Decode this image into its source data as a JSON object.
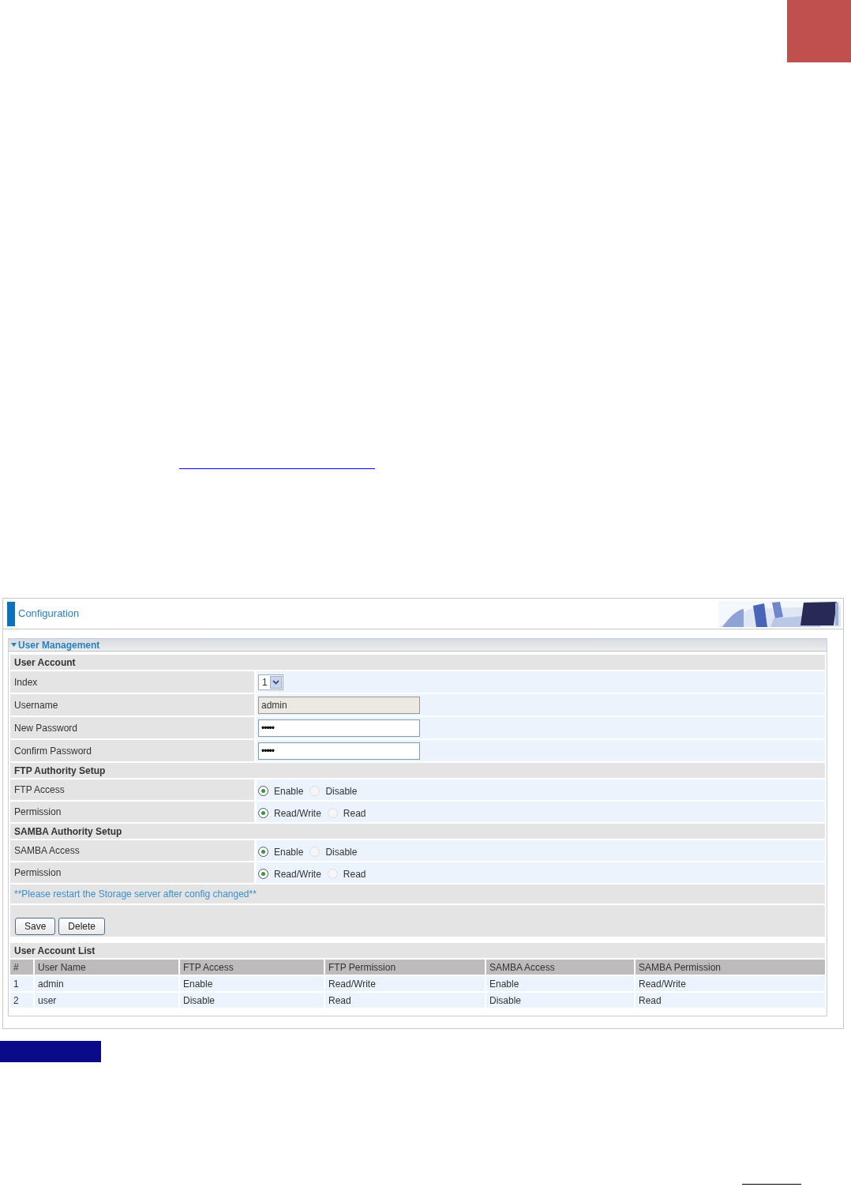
{
  "window": {
    "title": "Configuration"
  },
  "section": {
    "title": "User Management",
    "expanded": true
  },
  "groups": [
    {
      "heading": "User Account",
      "rows": [
        {
          "label": "Index",
          "kind": "select",
          "value": "1"
        },
        {
          "label": "Username",
          "kind": "text",
          "value": "admin",
          "disabled": true
        },
        {
          "label": "New Password",
          "kind": "password",
          "value": "•••••"
        },
        {
          "label": "Confirm Password",
          "kind": "password",
          "value": "•••••"
        }
      ]
    },
    {
      "heading": "FTP Authority Setup",
      "rows": [
        {
          "label": "FTP Access",
          "kind": "radio",
          "options": [
            {
              "label": "Enable",
              "selected": true
            },
            {
              "label": "Disable",
              "selected": false
            }
          ]
        },
        {
          "label": "Permission",
          "kind": "radio",
          "options": [
            {
              "label": "Read/Write",
              "selected": true
            },
            {
              "label": "Read",
              "selected": false
            }
          ]
        }
      ]
    },
    {
      "heading": "SAMBA Authority Setup",
      "rows": [
        {
          "label": "SAMBA Access",
          "kind": "radio",
          "options": [
            {
              "label": "Enable",
              "selected": true
            },
            {
              "label": "Disable",
              "selected": false
            }
          ]
        },
        {
          "label": "Permission",
          "kind": "radio",
          "options": [
            {
              "label": "Read/Write",
              "selected": true
            },
            {
              "label": "Read",
              "selected": false
            }
          ]
        }
      ]
    }
  ],
  "note": "**Please restart the Storage server after config changed**",
  "buttons": [
    "Save",
    "Delete"
  ],
  "list": {
    "title": "User Account List",
    "columns": [
      "#",
      "User Name",
      "FTP Access",
      "FTP Permission",
      "SAMBA Access",
      "SAMBA Permission"
    ],
    "rows": [
      [
        "1",
        "admin",
        "Enable",
        "Read/Write",
        "Enable",
        "Read/Write"
      ],
      [
        "2",
        "user",
        "Disable",
        "Read",
        "Disable",
        "Read"
      ]
    ]
  }
}
